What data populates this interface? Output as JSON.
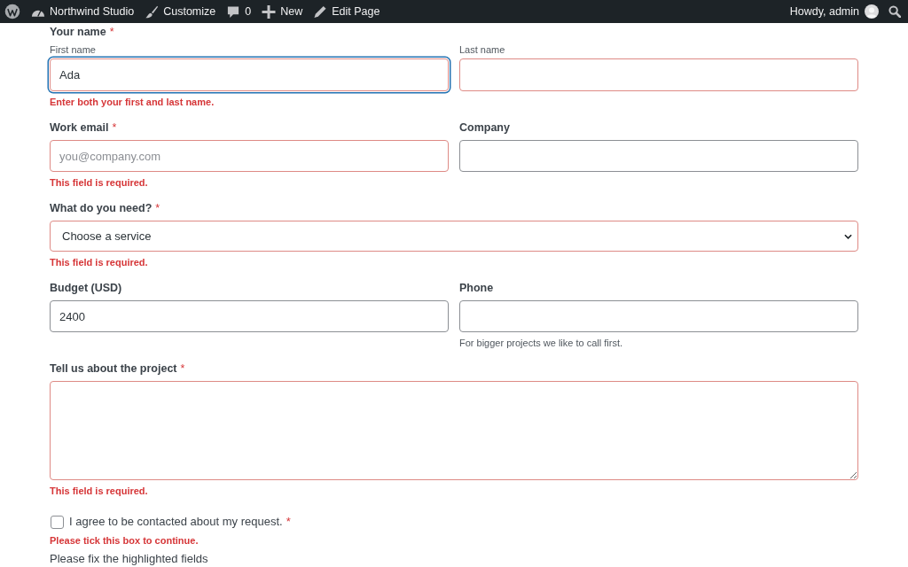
{
  "admin_bar": {
    "items": [
      {
        "kind": "site",
        "label": "Northwind Studio"
      },
      {
        "kind": "customize",
        "label": "Customize"
      },
      {
        "kind": "comments",
        "label": "0"
      },
      {
        "kind": "new",
        "label": "New"
      },
      {
        "kind": "edit",
        "label": "Edit Page"
      }
    ],
    "greeting": "Howdy, admin"
  },
  "form": {
    "rows": [
      {
        "legend": "Your name",
        "required_mark": "*",
        "fields": [
          {
            "kind": "text",
            "label": "First name",
            "value": "Ada",
            "invalid": true,
            "focused": true
          },
          {
            "kind": "text",
            "label": "Last name",
            "invalid": true,
            "focused": false
          }
        ],
        "error": "Enter both your first and last name."
      },
      {
        "fields": [
          {
            "kind": "text",
            "label": "Work email",
            "required_mark": "*",
            "placeholder": "you@company.com",
            "invalid": true,
            "focused": false,
            "error": "This field is required."
          },
          {
            "kind": "text",
            "label": "Company",
            "invalid": false,
            "focused": false
          }
        ]
      },
      {
        "fields": [
          {
            "kind": "select",
            "label": "What do you need?",
            "required_mark": "*",
            "value": "Choose a service",
            "invalid": true,
            "focused": false,
            "error": "This field is required."
          }
        ]
      },
      {
        "fields": [
          {
            "kind": "text",
            "label": "Budget (USD)",
            "value": "2400",
            "invalid": false,
            "focused": false
          },
          {
            "kind": "text",
            "label": "Phone",
            "invalid": false,
            "focused": false,
            "help": "For bigger projects we like to call first."
          }
        ]
      },
      {
        "fields": [
          {
            "kind": "textarea",
            "label": "Tell us about the project",
            "required_mark": "*",
            "invalid": true,
            "focused": false,
            "error": "This field is required."
          }
        ]
      },
      {
        "fields": [
          {
            "kind": "checkbox",
            "label": "I agree to be contacted about my request.",
            "required_mark": "*",
            "checked": false,
            "error": "Please tick this box to continue."
          }
        ]
      }
    ],
    "summary": "Please fix the highlighted fields"
  }
}
